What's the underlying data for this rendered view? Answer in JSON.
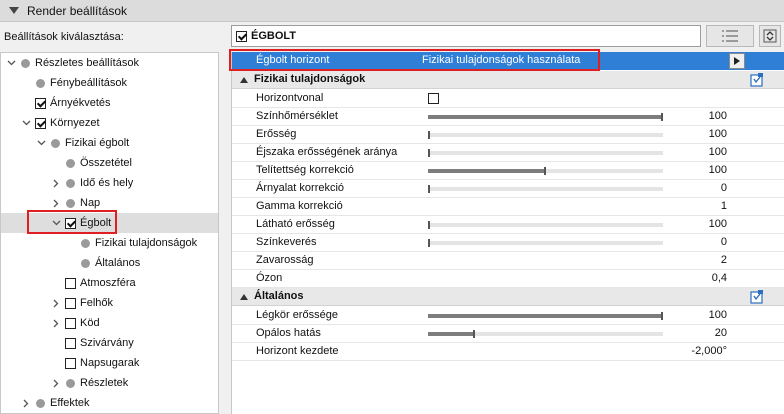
{
  "header": {
    "title": "Render beállítások"
  },
  "left_label": "Beállítások kiválasztása:",
  "tree": [
    {
      "label": "Részletes beállítások",
      "depth": 0,
      "expander": "down",
      "marker": "dot"
    },
    {
      "label": "Fénybeállítások",
      "depth": 1,
      "expander": "none",
      "marker": "dot"
    },
    {
      "label": "Árnyékvetés",
      "depth": 1,
      "expander": "none",
      "marker": "checked"
    },
    {
      "label": "Környezet",
      "depth": 1,
      "expander": "down",
      "marker": "checked"
    },
    {
      "label": "Fizikai égbolt",
      "depth": 2,
      "expander": "down",
      "marker": "dot"
    },
    {
      "label": "Összetétel",
      "depth": 3,
      "expander": "none",
      "marker": "dot"
    },
    {
      "label": "Idő és hely",
      "depth": 3,
      "expander": "right",
      "marker": "dot"
    },
    {
      "label": "Nap",
      "depth": 3,
      "expander": "right",
      "marker": "dot"
    },
    {
      "label": "Égbolt",
      "depth": 3,
      "expander": "down",
      "marker": "checked",
      "selected": true
    },
    {
      "label": "Fizikai tulajdonságok",
      "depth": 4,
      "expander": "none",
      "marker": "dot"
    },
    {
      "label": "Általános",
      "depth": 4,
      "expander": "none",
      "marker": "dot"
    },
    {
      "label": "Atmoszféra",
      "depth": 3,
      "expander": "none",
      "marker": "unchecked"
    },
    {
      "label": "Felhők",
      "depth": 3,
      "expander": "right",
      "marker": "unchecked"
    },
    {
      "label": "Köd",
      "depth": 3,
      "expander": "right",
      "marker": "unchecked"
    },
    {
      "label": "Szivárvány",
      "depth": 3,
      "expander": "none",
      "marker": "unchecked"
    },
    {
      "label": "Napsugarak",
      "depth": 3,
      "expander": "none",
      "marker": "unchecked"
    },
    {
      "label": "Részletek",
      "depth": 3,
      "expander": "right",
      "marker": "dot"
    },
    {
      "label": "Effektek",
      "depth": 1,
      "expander": "right",
      "marker": "dot"
    }
  ],
  "top_field": {
    "label": "ÉGBOLT",
    "checked": true
  },
  "selected_row": {
    "name": "Égbolt horizont",
    "value": "Fizikai tulajdonságok használata"
  },
  "groups": [
    {
      "title": "Fizikai tulajdonságok",
      "rows": [
        {
          "name": "Horizontvonal",
          "type": "checkbox",
          "checked": false
        },
        {
          "name": "Színhőmérséklet",
          "type": "slider",
          "value": "100",
          "fill": 1.0
        },
        {
          "name": "Erősség",
          "type": "slider",
          "value": "100",
          "fill": 0.0
        },
        {
          "name": "Éjszaka erősségének aránya",
          "type": "slider",
          "value": "100",
          "fill": 0.0
        },
        {
          "name": "Telítettség korrekció",
          "type": "slider",
          "value": "100",
          "fill": 0.5
        },
        {
          "name": "Árnyalat korrekció",
          "type": "slider",
          "value": "0",
          "fill": 0.0
        },
        {
          "name": "Gamma korrekció",
          "type": "text",
          "value": "1"
        },
        {
          "name": "Látható erősség",
          "type": "slider",
          "value": "100",
          "fill": 0.0
        },
        {
          "name": "Színkeverés",
          "type": "slider",
          "value": "0",
          "fill": 0.0
        },
        {
          "name": "Zavarosság",
          "type": "text",
          "value": "2"
        },
        {
          "name": "Ózon",
          "type": "text",
          "value": "0,4"
        }
      ]
    },
    {
      "title": "Általános",
      "rows": [
        {
          "name": "Légkör erőssége",
          "type": "slider",
          "value": "100",
          "fill": 1.0
        },
        {
          "name": "Opálos hatás",
          "type": "slider",
          "value": "20",
          "fill": 0.2
        },
        {
          "name": "Horizont kezdete",
          "type": "text",
          "value": "-2,000°"
        }
      ]
    }
  ],
  "icons": {
    "header_toggle": "collapse-triangle-icon",
    "list_button": "list-settings-icon",
    "expand_button": "expand-panel-icon",
    "group_help": "info-book-icon"
  },
  "colors": {
    "selection": "#2f7fd6",
    "highlight": "#e02020",
    "slider_fill": "#7d7d7d"
  }
}
